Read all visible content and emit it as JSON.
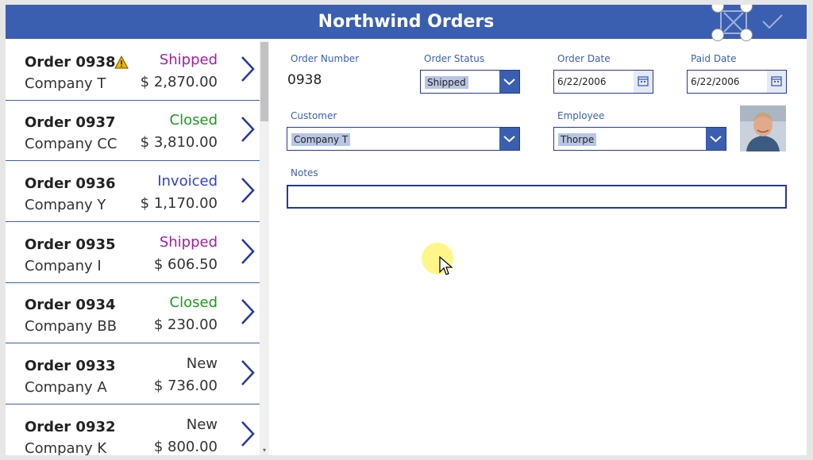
{
  "header": {
    "title": "Northwind Orders"
  },
  "orders": [
    {
      "title": "Order 0938",
      "company": "Company T",
      "status": "Shipped",
      "amount": "$ 2,870.00",
      "status_color": "#a020a0",
      "warning": true
    },
    {
      "title": "Order 0937",
      "company": "Company CC",
      "status": "Closed",
      "amount": "$ 3,810.00",
      "status_color": "#1d9a1d",
      "warning": false
    },
    {
      "title": "Order 0936",
      "company": "Company Y",
      "status": "Invoiced",
      "amount": "$ 1,170.00",
      "status_color": "#2f3ee0",
      "warning": false
    },
    {
      "title": "Order 0935",
      "company": "Company I",
      "status": "Shipped",
      "amount": "$ 606.50",
      "status_color": "#a020a0",
      "warning": false
    },
    {
      "title": "Order 0934",
      "company": "Company BB",
      "status": "Closed",
      "amount": "$ 230.00",
      "status_color": "#1d9a1d",
      "warning": false
    },
    {
      "title": "Order 0933",
      "company": "Company A",
      "status": "New",
      "amount": "$ 736.00",
      "status_color": "#333333",
      "warning": false
    },
    {
      "title": "Order 0932",
      "company": "Company K",
      "status": "New",
      "amount": "$ 800.00",
      "status_color": "#333333",
      "warning": false
    }
  ],
  "form": {
    "order_number_label": "Order Number",
    "order_number": "0938",
    "order_status_label": "Order Status",
    "order_status": "Shipped",
    "order_date_label": "Order Date",
    "order_date": "6/22/2006",
    "paid_date_label": "Paid Date",
    "paid_date": "6/22/2006",
    "customer_label": "Customer",
    "customer": "Company T",
    "employee_label": "Employee",
    "employee": "Thorpe",
    "notes_label": "Notes",
    "notes": ""
  },
  "colors": {
    "accent": "#3a5fb0",
    "border": "#23399a"
  },
  "icons": [
    "cancel-icon",
    "check-icon",
    "chevron-right-icon",
    "warning-icon",
    "calendar-icon",
    "chevron-down-icon"
  ]
}
